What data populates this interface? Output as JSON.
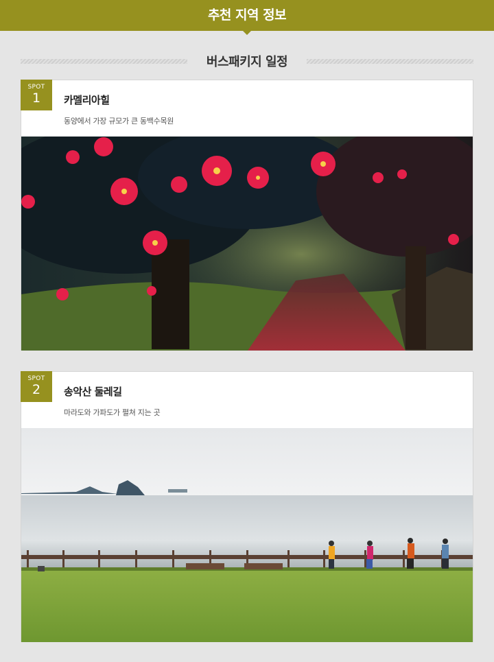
{
  "header": {
    "title": "추천 지역 정보"
  },
  "section": {
    "title": "버스패키지 일정"
  },
  "spots": [
    {
      "badge_label": "SPOT",
      "number": "1",
      "name": "카멜리아힐",
      "description": "동양에서 가장 규모가 큰 동백수목원",
      "photo_subject": "camellia-garden-path-photo"
    },
    {
      "badge_label": "SPOT",
      "number": "2",
      "name": "송악산 둘레길",
      "description": "마라도와 가파도가 펼쳐 지는 곳",
      "photo_subject": "seaside-trail-hikers-photo"
    }
  ],
  "colors": {
    "accent": "#96911f",
    "background": "#e5e5e5",
    "card": "#ffffff"
  }
}
